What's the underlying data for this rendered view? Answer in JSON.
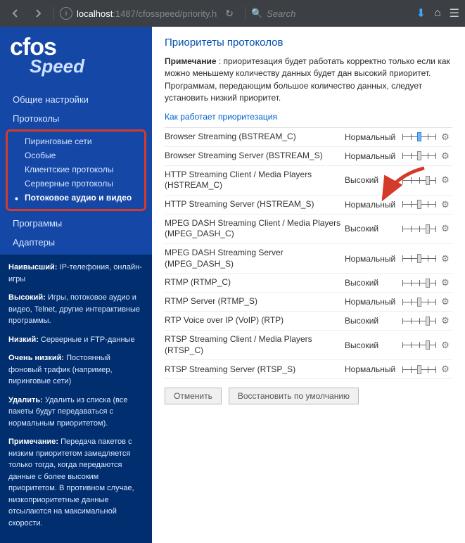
{
  "toolbar": {
    "url_host": "localhost",
    "url_port": ":1487",
    "url_path": "/cfosspeed/priority.h",
    "search_placeholder": "Search"
  },
  "logo": {
    "brand1": "cfos",
    "brand2": "Speed"
  },
  "nav": {
    "general": "Общие настройки",
    "protocols": "Протоколы",
    "sub": {
      "p2p": "Пиринговые сети",
      "special": "Особые",
      "client": "Клиентские протоколы",
      "server": "Серверные протоколы",
      "streaming": "Потоковое аудио и видео"
    },
    "programs": "Программы",
    "adapters": "Адаптеры"
  },
  "legend": {
    "l1b": "Наивысший:",
    "l1": " IP-телефония, онлайн-игры",
    "l2b": "Высокий:",
    "l2": " Игры, потоковое аудио и видео, Telnet, другие интерактивные программы.",
    "l3b": "Низкий:",
    "l3": " Серверные и FTP-данные",
    "l4b": "Очень низкий:",
    "l4": " Постоянный фоновый трафик (например, пиринговые сети)",
    "l5b": "Удалить:",
    "l5": " Удалить из списка (все пакеты будут передаваться с нормальным приоритетом).",
    "l6b": "Примечание:",
    "l6": " Передача пакетов с низким приоритетом замедляется только тогда, когда передаются данные с более высоким приоритетом. В противном случае, низкоприоритетные данные отсылаются на максимальной скорости."
  },
  "main": {
    "title": "Приоритеты протоколов",
    "note_b": "Примечание",
    "note": " : приоритезация будет работать корректно только если как можно меньшему количеству данных будет дан высокий приоритет. Программам, передающим большое количество данных, следует установить низкий приоритет.",
    "link": "Как работает приоритезация"
  },
  "priorities": {
    "normal": "Нормальный",
    "high": "Высокий"
  },
  "protocols": [
    {
      "name": "Browser Streaming (BSTREAM_C)",
      "priority": "normal",
      "pos": "p2",
      "highlight": true
    },
    {
      "name": "Browser Streaming Server (BSTREAM_S)",
      "priority": "normal",
      "pos": "p2"
    },
    {
      "name": "HTTP Streaming Client / Media Players (HSTREAM_C)",
      "priority": "high",
      "pos": "p3"
    },
    {
      "name": "HTTP Streaming Server (HSTREAM_S)",
      "priority": "normal",
      "pos": "p2"
    },
    {
      "name": "MPEG DASH Streaming Client / Media Players (MPEG_DASH_C)",
      "priority": "high",
      "pos": "p3"
    },
    {
      "name": "MPEG DASH Streaming Server (MPEG_DASH_S)",
      "priority": "normal",
      "pos": "p2"
    },
    {
      "name": "RTMP (RTMP_C)",
      "priority": "high",
      "pos": "p3"
    },
    {
      "name": "RTMP Server (RTMP_S)",
      "priority": "normal",
      "pos": "p2"
    },
    {
      "name": "RTP Voice over IP (VoIP) (RTP)",
      "priority": "high",
      "pos": "p3"
    },
    {
      "name": "RTSP Streaming Client / Media Players (RTSP_C)",
      "priority": "high",
      "pos": "p3"
    },
    {
      "name": "RTSP Streaming Server (RTSP_S)",
      "priority": "normal",
      "pos": "p2"
    }
  ],
  "buttons": {
    "cancel": "Отменить",
    "reset": "Восстановить по умолчанию"
  }
}
